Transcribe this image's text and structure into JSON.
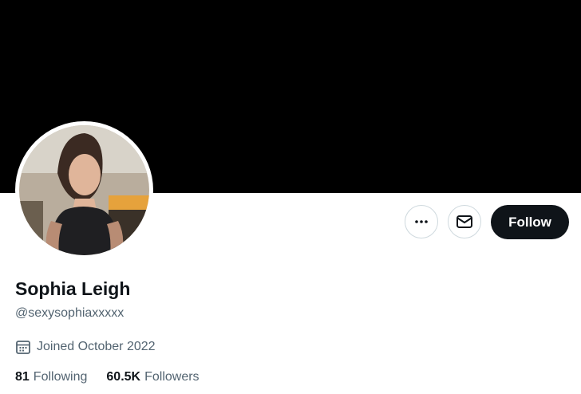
{
  "colors": {
    "banner": "#000000",
    "text_primary": "#0f1419",
    "text_secondary": "#536471",
    "button_border": "#cfd9de",
    "follow_bg": "#0f1419",
    "follow_text": "#ffffff"
  },
  "profile": {
    "display_name": "Sophia Leigh",
    "handle": "@sexysophiaxxxxx",
    "joined": "Joined October 2022",
    "avatar_icon": "profile-photo"
  },
  "actions": {
    "more_icon": "more-dots-icon",
    "message_icon": "envelope-icon",
    "follow_label": "Follow"
  },
  "stats": {
    "following_count": "81",
    "following_label": "Following",
    "followers_count": "60.5K",
    "followers_label": "Followers"
  }
}
